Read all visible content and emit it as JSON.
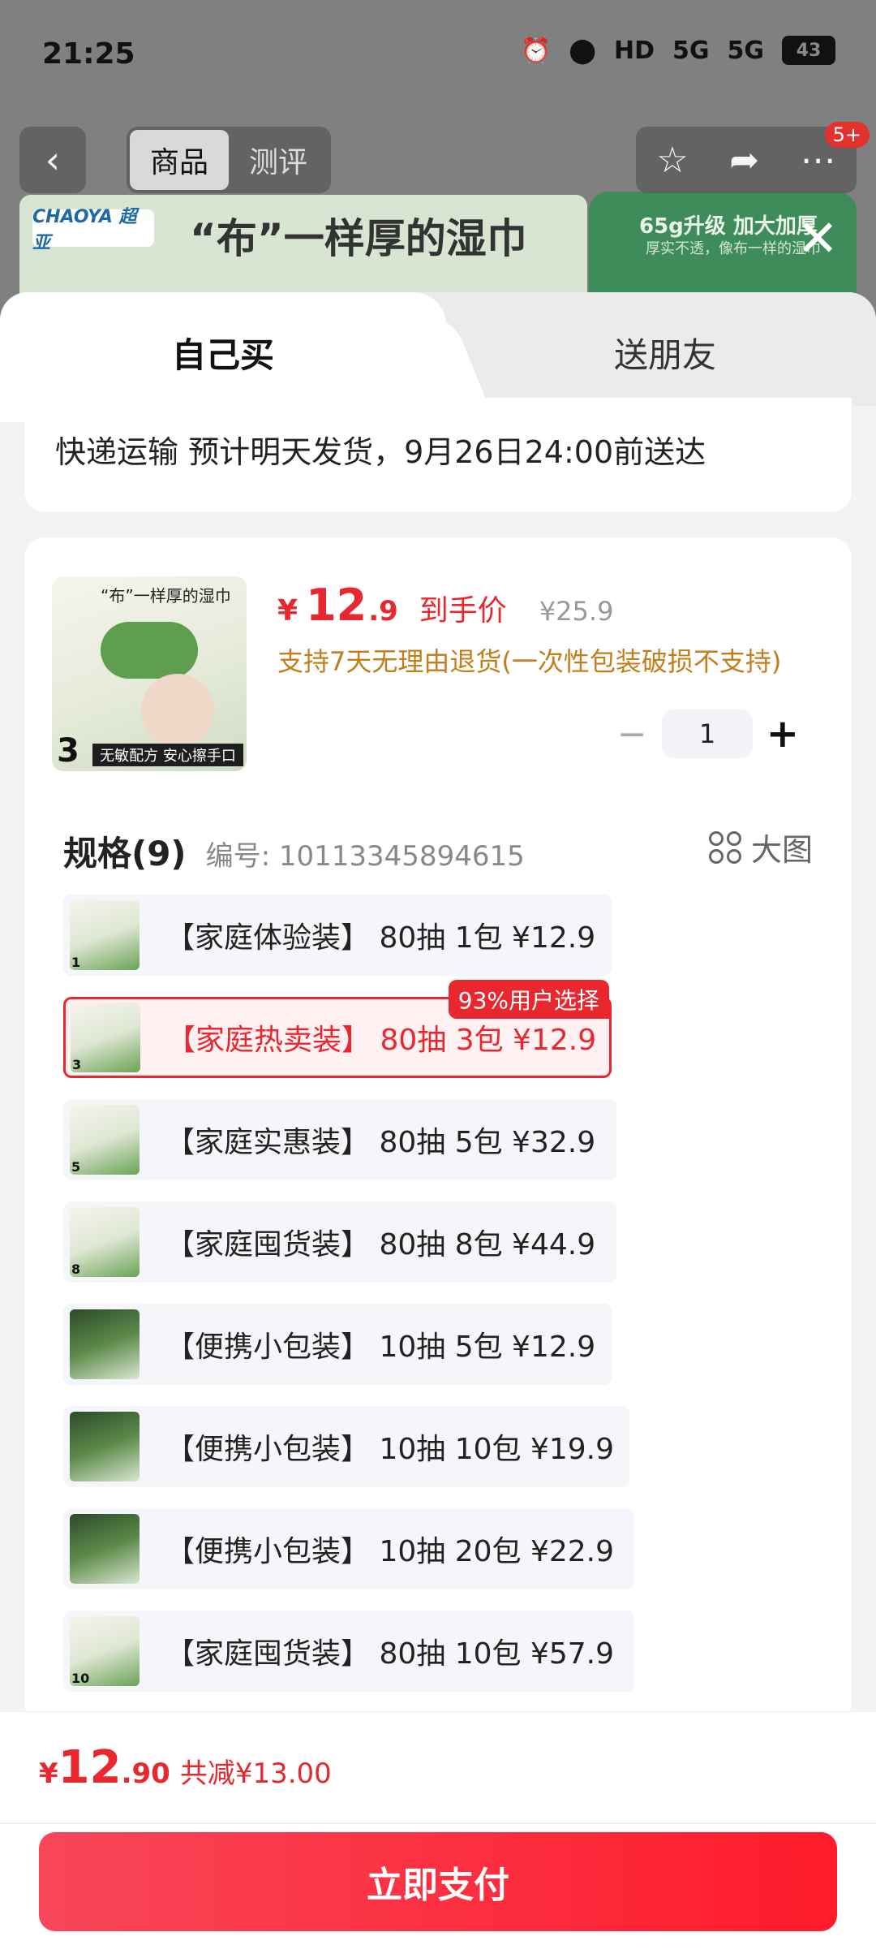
{
  "status": {
    "time": "21:25",
    "battery": "43",
    "network": [
      "HD",
      "5G",
      "5G"
    ]
  },
  "nav": {
    "back": "‹",
    "tab_goods": "商品",
    "tab_review": "测评",
    "badge": "5+"
  },
  "banner": {
    "logo": "CHAOYA 超亚",
    "title": "“布”一样厚的湿巾",
    "right_title": "65g升级 加大加厚",
    "right_sub": "厚实不透，像布一样的湿巾"
  },
  "sheet": {
    "tab_self": "自己买",
    "tab_friend": "送朋友",
    "delivery": "快递运输 预计明天发货，9月26日24:00前送达"
  },
  "product": {
    "thumb_title": "“布”一样厚的湿巾",
    "thumb_footer": "无敏配方 安心擦手口",
    "thumb_num": "3",
    "currency": "¥",
    "price_int": "12",
    "price_dec": ".9",
    "final_label": "到手价",
    "orig_price": "¥25.9",
    "return_policy": "支持7天无理由退货(一次性包装破损不支持)",
    "qty": "1"
  },
  "spec": {
    "title": "规格(9)",
    "code": "编号: 10113345894615",
    "bigview": "大图",
    "popular_badge": "93%用户选择",
    "options": [
      {
        "num": "1",
        "text": "【家庭体验装】 80抽 1包  ¥12.9"
      },
      {
        "num": "3",
        "text": "【家庭热卖装】 80抽 3包  ¥12.9"
      },
      {
        "num": "5",
        "text": "【家庭实惠装】 80抽 5包  ¥32.9"
      },
      {
        "num": "8",
        "text": "【家庭囤货装】 80抽 8包  ¥44.9"
      },
      {
        "num": "",
        "text": "【便携小包装】 10抽 5包  ¥12.9"
      },
      {
        "num": "",
        "text": "【便携小包装】 10抽 10包  ¥19.9"
      },
      {
        "num": "",
        "text": "【便携小包装】 10抽 20包  ¥22.9"
      },
      {
        "num": "10",
        "text": "【家庭囤货装】 80抽 10包  ¥57.9"
      }
    ]
  },
  "footer": {
    "currency": "¥",
    "total_int": "12",
    "total_dec": ".90",
    "save": "共减¥13.00",
    "pay_label": "立即支付"
  }
}
